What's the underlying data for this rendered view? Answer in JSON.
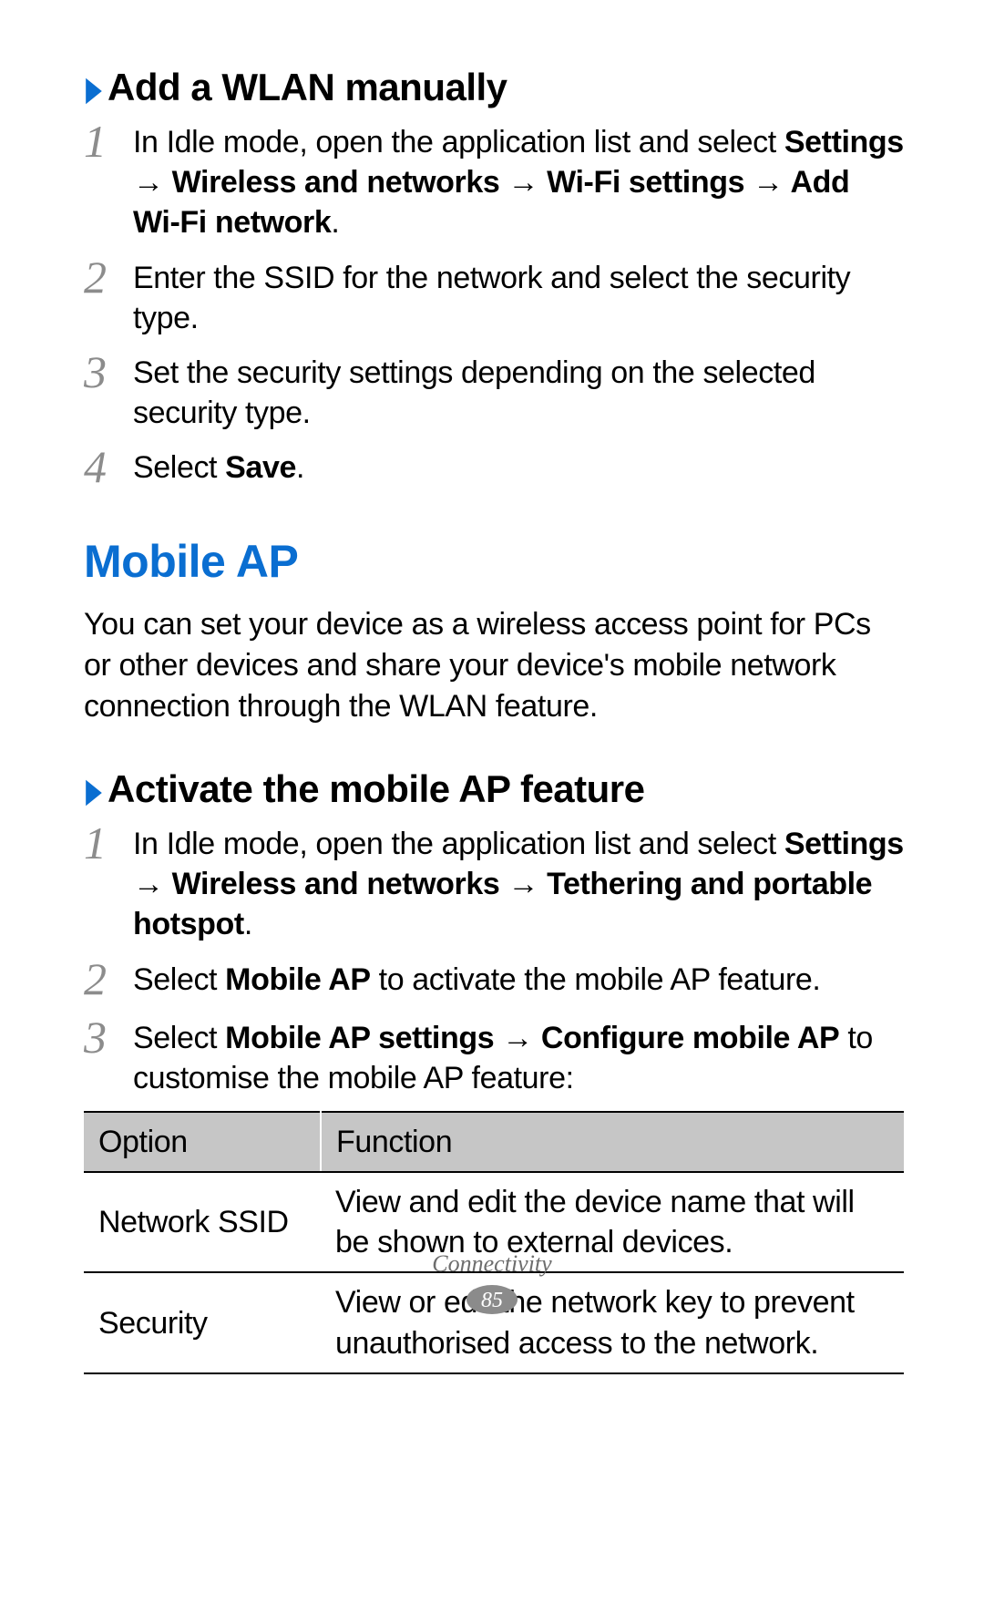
{
  "section_add_wlan": {
    "title": "Add a WLAN manually",
    "steps": [
      {
        "num": "1",
        "pre": "In Idle mode, open the application list and select ",
        "bold": "Settings → Wireless and networks → Wi-Fi settings → Add Wi-Fi network",
        "post": "."
      },
      {
        "num": "2",
        "pre": "Enter the SSID for the network and select the security type.",
        "bold": "",
        "post": ""
      },
      {
        "num": "3",
        "pre": "Set the security settings depending on the selected security type.",
        "bold": "",
        "post": ""
      },
      {
        "num": "4",
        "pre": "Select ",
        "bold": "Save",
        "post": "."
      }
    ]
  },
  "mobile_ap": {
    "title": "Mobile AP",
    "intro": "You can set your device as a wireless access point for PCs or other devices and share your device's mobile network connection through the WLAN feature."
  },
  "section_activate_ap": {
    "title": "Activate the mobile AP feature",
    "steps": [
      {
        "num": "1",
        "pre": "In Idle mode, open the application list and select ",
        "bold": "Settings → Wireless and networks → Tethering and portable hotspot",
        "post": "."
      },
      {
        "num": "2",
        "pre": "Select ",
        "bold": "Mobile AP",
        "post": " to activate the mobile AP feature."
      },
      {
        "num": "3",
        "pre": "Select ",
        "bold": "Mobile AP settings → Configure mobile AP",
        "post": " to customise the mobile AP feature:"
      }
    ]
  },
  "ap_table": {
    "header": {
      "c1": "Option",
      "c2": "Function"
    },
    "rows": [
      {
        "c1": "Network SSID",
        "c2": "View and edit the device name that will be shown to external devices."
      },
      {
        "c1": "Security",
        "c2": "View or edit the network key to prevent unauthorised access to the network."
      }
    ]
  },
  "footer": {
    "category": "Connectivity",
    "page_number": "85"
  }
}
